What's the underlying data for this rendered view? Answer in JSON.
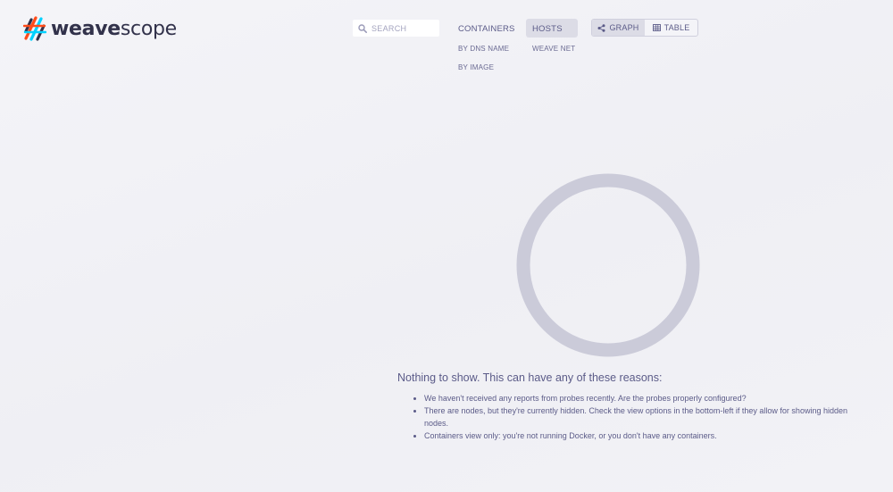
{
  "logo": {
    "bold": "weave",
    "light": "scope",
    "icon": "weave-logo-icon",
    "colors": [
      "#ff4b19",
      "#00d2ff",
      "#32324b"
    ]
  },
  "search": {
    "placeholder": "SEARCH",
    "value": "",
    "icon": "search-icon"
  },
  "topologies": {
    "containers": "CONTAINERS",
    "by_dns_name": "BY DNS NAME",
    "by_image": "BY IMAGE",
    "hosts": "HOSTS",
    "weave_net": "WEAVE NET",
    "active": "HOSTS"
  },
  "view_toggle": {
    "graph": "GRAPH",
    "table": "TABLE",
    "active": "GRAPH",
    "graph_icon": "share-icon",
    "table_icon": "table-icon"
  },
  "empty_state": {
    "title": "Nothing to show. This can have any of these reasons:",
    "reasons": [
      "We haven't received any reports from probes recently. Are the probes properly configured?",
      "There are nodes, but they're currently hidden. Check the view options in the bottom-left if they allow for showing hidden nodes.",
      "Containers view only: you're not running Docker, or you don't have any containers."
    ]
  },
  "colors": {
    "accent_text": "#5b5b88",
    "active_bg": "#dcdce6",
    "ring": "#cbcbd9"
  }
}
